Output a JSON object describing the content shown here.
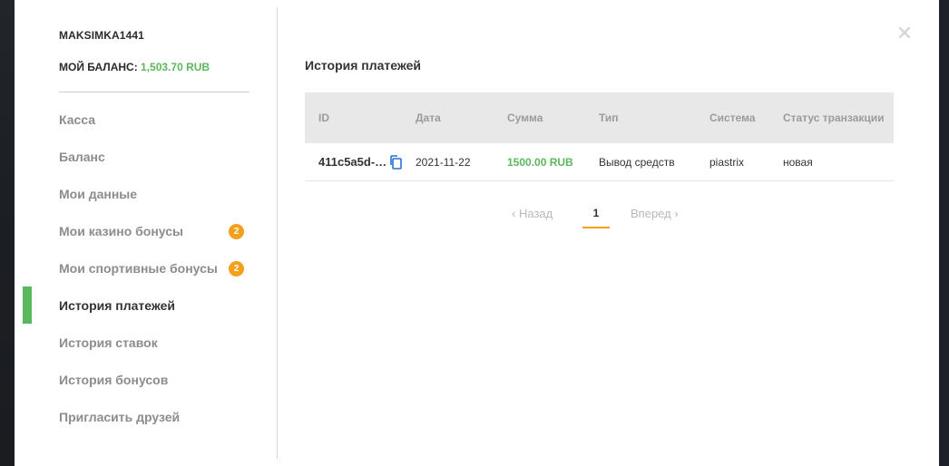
{
  "profile": {
    "username": "MAKSIMKA1441",
    "balance_label": "МОЙ БАЛАНС:",
    "balance_value": "1,503.70 RUB"
  },
  "sidebar": {
    "items": [
      {
        "label": "Касса",
        "badge": null,
        "active": false
      },
      {
        "label": "Баланс",
        "badge": null,
        "active": false
      },
      {
        "label": "Мои данные",
        "badge": null,
        "active": false
      },
      {
        "label": "Мои казино бонусы",
        "badge": "2",
        "active": false
      },
      {
        "label": "Мои спортивные бонусы",
        "badge": "2",
        "active": false
      },
      {
        "label": "История платежей",
        "badge": null,
        "active": true
      },
      {
        "label": "История ставок",
        "badge": null,
        "active": false
      },
      {
        "label": "История бонусов",
        "badge": null,
        "active": false
      },
      {
        "label": "Пригласить друзей",
        "badge": null,
        "active": false
      }
    ]
  },
  "main": {
    "close_icon": "close-icon",
    "title": "История платежей",
    "table": {
      "columns": [
        "ID",
        "Дата",
        "Сумма",
        "Тип",
        "Система",
        "Статус транзакции"
      ],
      "rows": [
        {
          "id": "411c5a5d-…",
          "date": "2021-11-22",
          "amount": "1500.00 RUB",
          "type": "Вывод средств",
          "system": "piastrix",
          "status": "новая"
        }
      ]
    },
    "pagination": {
      "prev": "Назад",
      "current": "1",
      "next": "Вперед"
    }
  },
  "colors": {
    "accent_green": "#5cb85c",
    "badge_orange": "#f5a01a",
    "copy_icon_blue": "#2a6fd6"
  }
}
